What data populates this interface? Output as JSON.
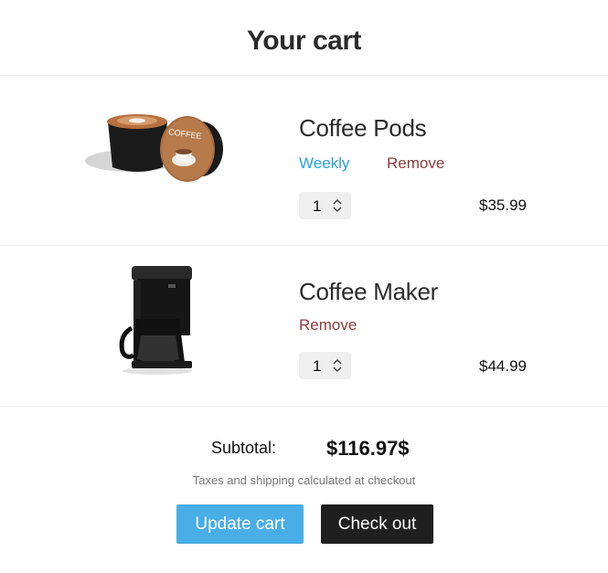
{
  "page": {
    "title": "Your cart"
  },
  "items": [
    {
      "name": "Coffee Pods",
      "frequency": "Weekly",
      "remove_label": "Remove",
      "quantity": "1",
      "price": "$35.99",
      "image_icon": "coffee-pods-image",
      "pod_label": "COFFEE"
    },
    {
      "name": "Coffee Maker",
      "remove_label": "Remove",
      "quantity": "1",
      "price": "$44.99",
      "image_icon": "coffee-maker-image"
    }
  ],
  "summary": {
    "subtotal_label": "Subtotal:",
    "subtotal_value": "$116.97$",
    "note": "Taxes and shipping calculated at checkout"
  },
  "actions": {
    "update_label": "Update cart",
    "checkout_label": "Check out"
  },
  "colors": {
    "link_blue": "#2aa3d6",
    "remove_red": "#8e3b3b",
    "update_button": "#49aee6",
    "checkout_button": "#1f1f1f"
  }
}
